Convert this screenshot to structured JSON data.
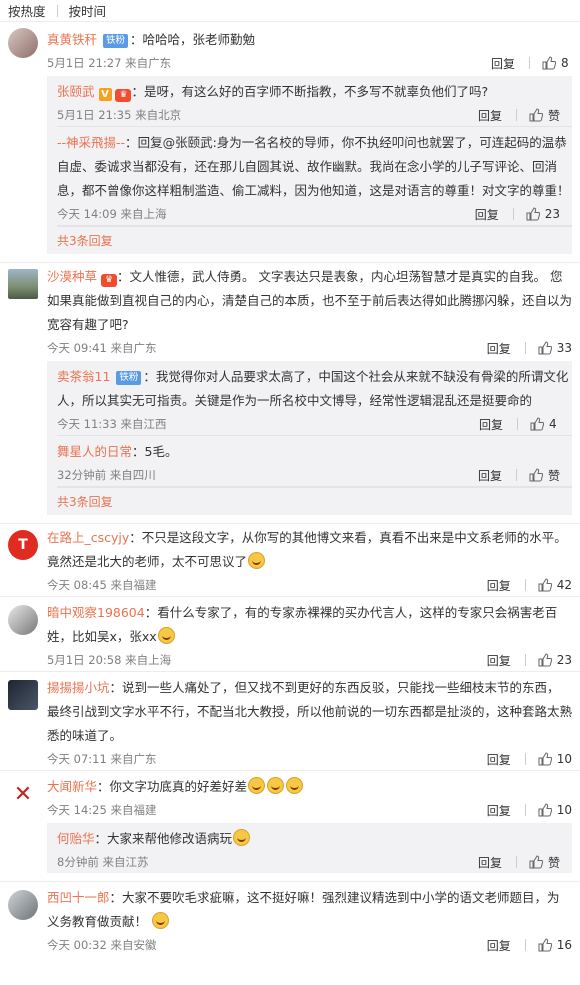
{
  "sort": {
    "hot": "按热度",
    "time": "按时间"
  },
  "labels": {
    "reply": "回复",
    "like": "赞"
  },
  "colors": {
    "username": "#eb7350",
    "badge": "#5a9be3",
    "subbg": "#f2f2f5"
  },
  "comments": [
    {
      "user": "真黄铁秆",
      "badge": "铁粉",
      "sep": "：",
      "text": "哈哈哈，张老师勤勉",
      "time": "5月1日 21:27 来自广东",
      "likes": "8",
      "subs": [
        {
          "user": "张颐武",
          "sep": "：",
          "text": "是呀，有这么好的百字师不断指教，不多写不就辜负他们了吗?",
          "time": "5月1日 21:35 来自北京",
          "likes": ""
        },
        {
          "user": "--神采飛揚--",
          "sep": "：",
          "text": "回复@张颐武:身为一名名校的导师，你不执经叩问也就罢了，可连起码的温恭自虚、委诚求当都没有，还在那儿自圆其说、故作幽默。我尚在念小学的儿子写评论、回消息，都不曾像你这样粗制滥造、偷工减料，因为他知道，这是对语言的尊重！对文字的尊重！",
          "time": "今天 14:09 来自上海",
          "likes": "23"
        }
      ],
      "more": "共3条回复"
    },
    {
      "user": "沙漠种草",
      "sep": "：",
      "text": "文人惟德，武人侍勇。 文字表达只是表象，内心坦荡智慧才是真实的自我。 您如果真能做到直视自己的内心，清楚自己的本质，也不至于前后表达得如此腾挪闪躲，还自以为宽容有趣了吧?",
      "time": "今天 09:41 来自广东",
      "likes": "33",
      "subs": [
        {
          "user": "卖茶翁11",
          "badge": "铁粉",
          "sep": "：",
          "text": "我觉得你对人品要求太高了，中国这个社会从来就不缺没有骨梁的所谓文化人，所以其实无可指责。关键是作为一所名校中文博导，经常性逻辑混乱还是挺要命的",
          "time": "今天 11:33 来自江西",
          "likes": "4"
        },
        {
          "user": "舞星人的日常",
          "sep": "：",
          "text": "5毛。",
          "time": "32分钟前 来自四川",
          "likes": ""
        }
      ],
      "more": "共3条回复"
    },
    {
      "user": "在路上_cscyjy",
      "sep": "：",
      "text": "不只是这段文字，从你写的其他博文来看，真看不出来是中文系老师的水平。竟然还是北大的老师，太不可思议了",
      "time": "今天 08:45 来自福建",
      "likes": "42",
      "avatar_text": "T"
    },
    {
      "user": "暗中观察198604",
      "sep": "：",
      "text": "看什么专家了，有的专家赤裸裸的买办代言人，这样的专家只会祸害老百姓，比如吴x，张xx",
      "time": "5月1日 20:58 来自上海",
      "likes": "23"
    },
    {
      "user": "揚揚揚小坑",
      "sep": "：",
      "text": "说到一些人痛处了，但又找不到更好的东西反驳，只能找一些细枝末节的东西，最终引战到文字水平不行，不配当北大教授，所以他前说的一切东西都是扯淡的，这种套路太熟悉的味道了。",
      "time": "今天 07:11 来自广东",
      "likes": "10"
    },
    {
      "user": "大闻新华",
      "sep": "：",
      "text": "你文字功底真的好差好差",
      "time": "今天 14:25 来自福建",
      "likes": "10",
      "subs": [
        {
          "user": "何贻华",
          "sep": "：",
          "text": "大家来帮他修改语病玩",
          "time": "8分钟前 来自江苏",
          "likes": ""
        }
      ]
    },
    {
      "user": "西凹十一郎",
      "sep": "：",
      "text": "大家不要吹毛求疵嘛，这不挺好嘛！强烈建议精选到中小学的语文老师题目，为义务教育做贡献！",
      "time": "今天 00:32 来自安徽",
      "likes": "16"
    }
  ]
}
